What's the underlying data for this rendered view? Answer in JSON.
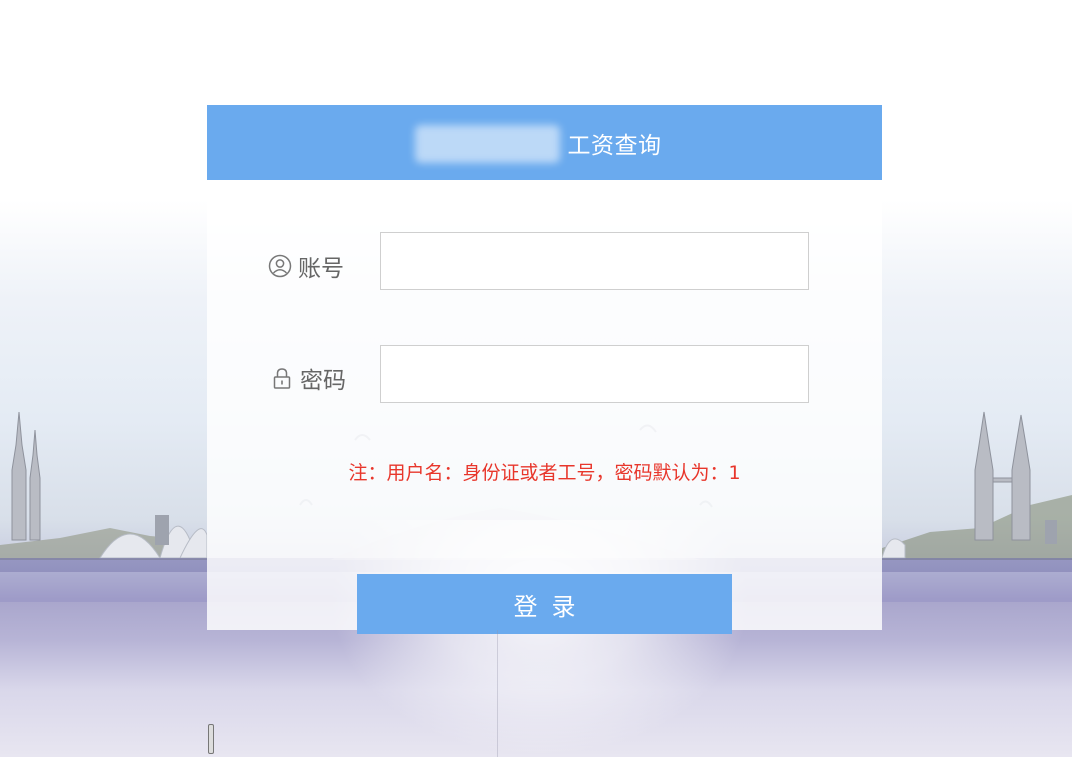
{
  "header": {
    "title": "工资查询"
  },
  "form": {
    "account": {
      "label": "账号",
      "icon": "user-circle-icon",
      "value": "",
      "placeholder": ""
    },
    "password": {
      "label": "密码",
      "icon": "lock-icon",
      "value": "",
      "placeholder": ""
    },
    "note": "注：用户名：身份证或者工号，密码默认为：1",
    "login_label": "登录"
  },
  "colors": {
    "accent": "#6aaaee",
    "note": "#e8362b",
    "label": "#666666"
  }
}
